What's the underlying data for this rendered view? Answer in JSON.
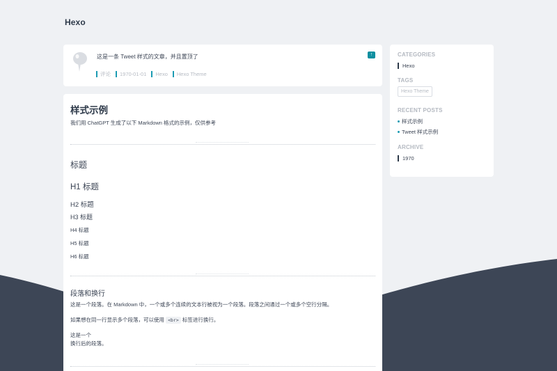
{
  "site": {
    "title": "Hexo"
  },
  "tweet": {
    "text": "这是一条 Tweet 样式的文章，并且置顶了",
    "pin_icon": "arrow-up-icon",
    "meta": [
      "评论",
      "1970-01-01",
      "Hexo",
      "Hexo Theme"
    ]
  },
  "post": {
    "title": "样式示例",
    "intro": "我们用 ChatGPT 生成了以下 Markdown 格式的示例，仅供参考",
    "section_heading": "标题",
    "headings": [
      "H1 标题",
      "H2 标题",
      "H3 标题",
      "H4 标题",
      "H5 标题",
      "H6 标题"
    ],
    "paragraph_section": {
      "title": "段落和换行",
      "para1": "这是一个段落。在 Markdown 中，一个或多个连续的文本行被视为一个段落。段落之间通过一个或多个空行分隔。",
      "para2_before": "如果想在同一行显示多个段落，可以使用",
      "para2_code": "<br>",
      "para2_after": "标签进行换行。",
      "para3_line1": "这是一个",
      "para3_line2": "换行后的段落。"
    }
  },
  "sidebar": {
    "categories_heading": "CATEGORIES",
    "categories": [
      "Hexo"
    ],
    "tags_heading": "TAGS",
    "tags": [
      "Hexo Theme"
    ],
    "recent_heading": "RECENT POSTS",
    "recent_posts": [
      "样式示例",
      "Tweet 样式示例"
    ],
    "archive_heading": "ARCHIVE",
    "archive": [
      "1970"
    ]
  },
  "colors": {
    "background": "#eff1f4",
    "wave": "#3d4656",
    "accent": "#1b9bb3",
    "text": "#3d4656",
    "muted": "#b7bcc4"
  }
}
